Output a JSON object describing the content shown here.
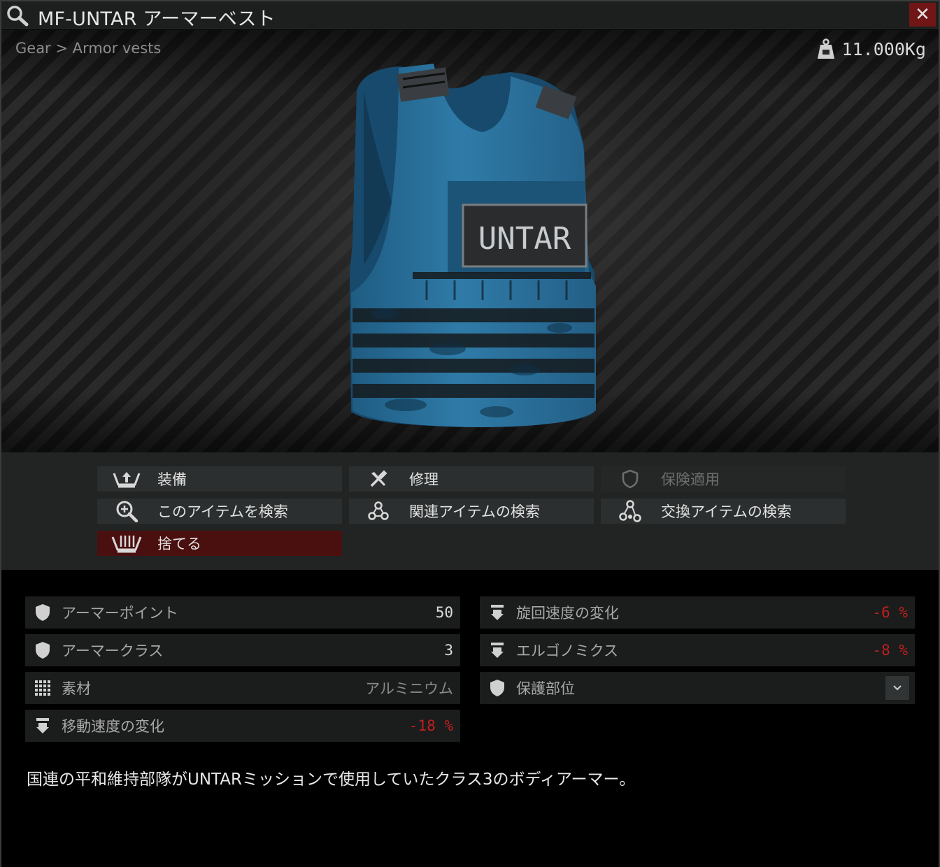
{
  "window": {
    "title": "MF-UNTAR アーマーベスト",
    "close_label": "✕"
  },
  "preview": {
    "breadcrumb": "Gear > Armor vests",
    "weight": "11.000Kg",
    "vest_patch_text": "UNTAR"
  },
  "actions": [
    {
      "label": "装備",
      "icon": "equip-icon",
      "state": "enabled"
    },
    {
      "label": "修理",
      "icon": "repair-icon",
      "state": "enabled"
    },
    {
      "label": "保険適用",
      "icon": "insurance-shield-icon",
      "state": "disabled"
    },
    {
      "label": "このアイテムを検索",
      "icon": "search-zoom-icon",
      "state": "enabled"
    },
    {
      "label": "関連アイテムの検索",
      "icon": "linked-items-icon",
      "state": "enabled"
    },
    {
      "label": "交換アイテムの検索",
      "icon": "barter-items-icon",
      "state": "enabled"
    },
    {
      "label": "捨てる",
      "icon": "discard-icon",
      "state": "danger"
    }
  ],
  "stats": {
    "left": [
      {
        "label": "アーマーポイント",
        "value": "50",
        "icon": "armor-shield-icon"
      },
      {
        "label": "アーマークラス",
        "value": "3",
        "icon": "armor-shield-icon"
      },
      {
        "label": "素材",
        "value": "アルミニウム",
        "icon": "material-grid-icon"
      },
      {
        "label": "移動速度の変化",
        "value": "-18 %",
        "icon": "speed-arrow-icon"
      }
    ],
    "right": [
      {
        "label": "旋回速度の変化",
        "value": "-6 %",
        "icon": "speed-arrow-icon"
      },
      {
        "label": "エルゴノミクス",
        "value": "-8 %",
        "icon": "speed-arrow-icon"
      },
      {
        "label": "保護部位",
        "value": "",
        "icon": "armor-shield-icon"
      }
    ]
  },
  "description": "国連の平和維持部隊がUNTARミッションで使用していたクラス3のボディアーマー。",
  "colors": {
    "negative": "#c01f1f",
    "danger_button": "#4a0f0f",
    "close_button": "#701616",
    "vest_blue": "#2f7ba8"
  }
}
